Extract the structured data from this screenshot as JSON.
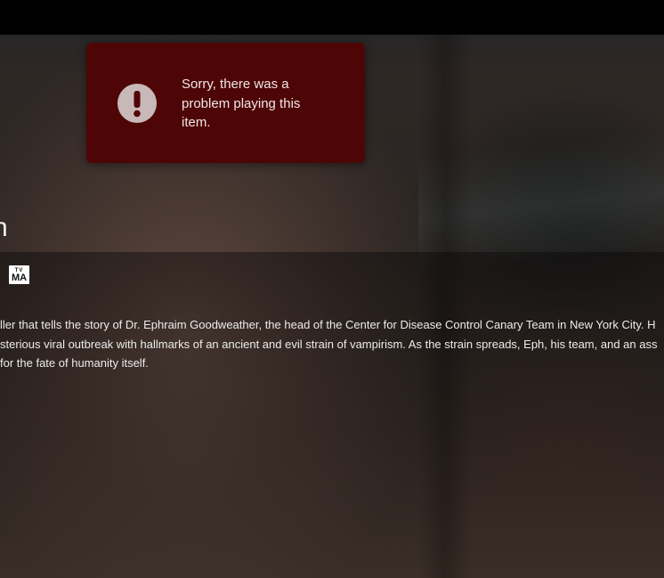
{
  "player": {
    "title_fragment": "n",
    "rating_badge": {
      "prefix": "TV",
      "rating": "MA"
    },
    "synopsis_lines": [
      "ller that tells the story of Dr. Ephraim Goodweather, the head of the Center for Disease Control Canary Team in New York City. H",
      "sterious viral outbreak with hallmarks of an ancient and evil strain of vampirism. As the strain spreads, Eph, his team, and an ass",
      " for the fate of humanity itself."
    ]
  },
  "error_toast": {
    "message": "Sorry, there was a problem playing this item.",
    "icon": "exclamation-circle-icon",
    "background_color": "#4e0505"
  }
}
